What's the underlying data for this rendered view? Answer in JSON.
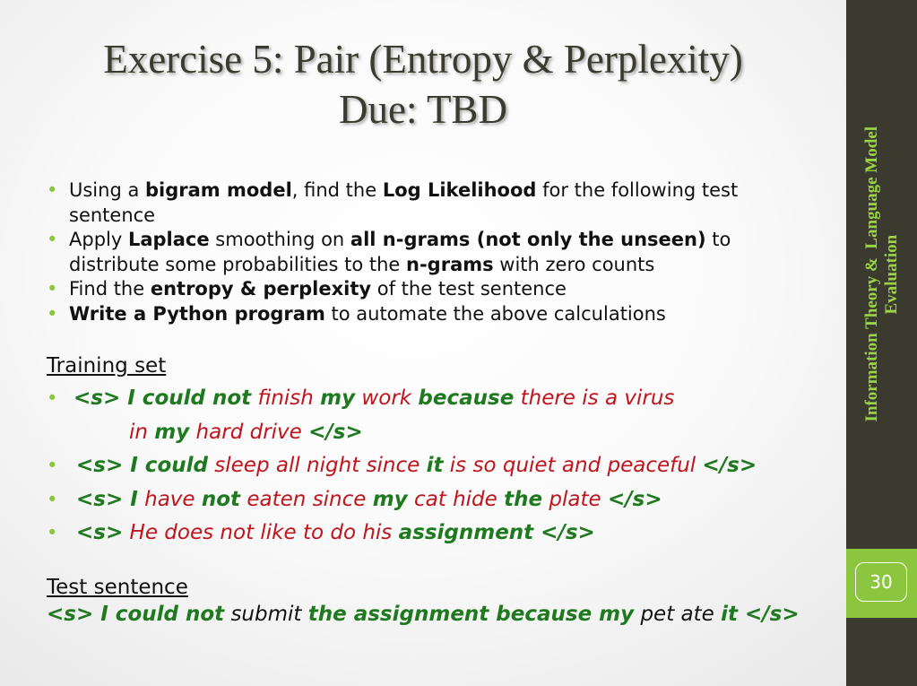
{
  "title": {
    "line1": "Exercise 5: Pair (Entropy & Perplexity)",
    "line2": "Due: TBD"
  },
  "bullets": [
    {
      "parts": [
        {
          "t": "Using a ",
          "s": "n"
        },
        {
          "t": "bigram model",
          "s": "b"
        },
        {
          "t": ", find the ",
          "s": "n"
        },
        {
          "t": "Log Likelihood",
          "s": "b"
        },
        {
          "t": " for the following test sentence",
          "s": "n"
        }
      ]
    },
    {
      "parts": [
        {
          "t": "Apply ",
          "s": "n"
        },
        {
          "t": "Laplace",
          "s": "b"
        },
        {
          "t": " smoothing on ",
          "s": "n"
        },
        {
          "t": "all n-grams (not only the unseen)",
          "s": "b"
        },
        {
          "t": " to distribute some probabilities to the ",
          "s": "n"
        },
        {
          "t": "n-grams",
          "s": "b"
        },
        {
          "t": " with zero counts",
          "s": "n"
        }
      ]
    },
    {
      "parts": [
        {
          "t": "Find the ",
          "s": "n"
        },
        {
          "t": "entropy & perplexity",
          "s": "b"
        },
        {
          "t": " of the test sentence",
          "s": "n"
        }
      ]
    },
    {
      "parts": [
        {
          "t": "Write a Python program",
          "s": "b"
        },
        {
          "t": " to automate the above calculations",
          "s": "n"
        }
      ]
    }
  ],
  "training": {
    "heading": "Training set",
    "sentences": [
      {
        "lines": [
          [
            {
              "t": "<s> I could not",
              "c": "g"
            },
            {
              "t": " finish ",
              "c": "r"
            },
            {
              "t": "my",
              "c": "g"
            },
            {
              "t": " work ",
              "c": "r"
            },
            {
              "t": "because",
              "c": "g"
            },
            {
              "t": " there is a virus",
              "c": "r"
            }
          ],
          [
            {
              "t": "in ",
              "c": "r"
            },
            {
              "t": "my",
              "c": "g"
            },
            {
              "t": " hard drive ",
              "c": "r"
            },
            {
              "t": "</s>",
              "c": "g"
            }
          ]
        ]
      },
      {
        "lines": [
          [
            {
              "t": "<s> I could",
              "c": "g"
            },
            {
              "t": " sleep all night since ",
              "c": "r"
            },
            {
              "t": "it",
              "c": "g"
            },
            {
              "t": " is so quiet and peaceful ",
              "c": "r"
            },
            {
              "t": "</s>",
              "c": "g"
            }
          ]
        ]
      },
      {
        "lines": [
          [
            {
              "t": "<s> I",
              "c": "g"
            },
            {
              "t": " have ",
              "c": "r"
            },
            {
              "t": "not",
              "c": "g"
            },
            {
              "t": " eaten since ",
              "c": "r"
            },
            {
              "t": "my",
              "c": "g"
            },
            {
              "t": " cat hide ",
              "c": "r"
            },
            {
              "t": "the",
              "c": "g"
            },
            {
              "t": " plate ",
              "c": "r"
            },
            {
              "t": "</s>",
              "c": "g"
            }
          ]
        ]
      },
      {
        "lines": [
          [
            {
              "t": "<s>",
              "c": "g"
            },
            {
              "t": " He does not like to do his ",
              "c": "r"
            },
            {
              "t": "assignment",
              "c": "g"
            },
            {
              "t": " </s>",
              "c": "g"
            }
          ]
        ]
      }
    ]
  },
  "test": {
    "heading": "Test sentence",
    "parts": [
      {
        "t": "<s> I could not",
        "c": "g"
      },
      {
        "t": " submit ",
        "c": "k"
      },
      {
        "t": "the assignment because my",
        "c": "g"
      },
      {
        "t": " pet ate ",
        "c": "k"
      },
      {
        "t": "it",
        "c": "g"
      },
      {
        "t": " </s>",
        "c": "g"
      }
    ]
  },
  "sidebar": {
    "line1": "Information Theory &  Language Model",
    "line2": "Evaluation"
  },
  "page_number": "30",
  "colors": {
    "green_text": "#1f7a1f",
    "red_text": "#c0141c",
    "accent": "#8cc63f",
    "sidebar_bg": "#3a3a2e"
  }
}
